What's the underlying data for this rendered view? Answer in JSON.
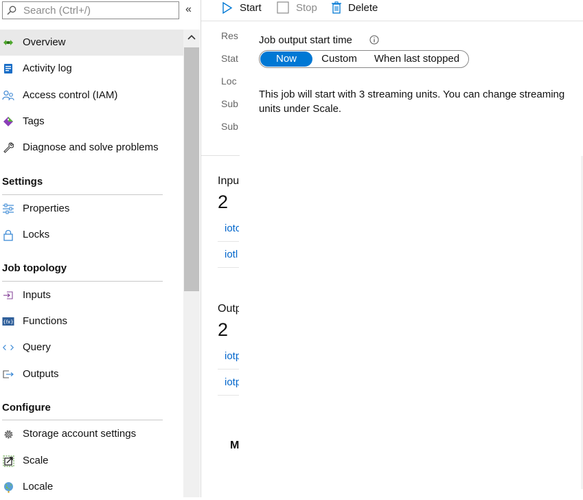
{
  "search": {
    "placeholder": "Search (Ctrl+/)"
  },
  "sidebar": {
    "collapse_glyph": "«",
    "items": [
      {
        "label": "Overview",
        "icon": "overview-icon",
        "active": true
      },
      {
        "label": "Activity log",
        "icon": "activity-log-icon"
      },
      {
        "label": "Access control (IAM)",
        "icon": "access-control-icon"
      },
      {
        "label": "Tags",
        "icon": "tag-icon"
      },
      {
        "label": "Diagnose and solve problems",
        "icon": "wrench-icon"
      }
    ],
    "sections": [
      {
        "title": "Settings",
        "items": [
          {
            "label": "Properties",
            "icon": "properties-icon"
          },
          {
            "label": "Locks",
            "icon": "lock-icon"
          }
        ]
      },
      {
        "title": "Job topology",
        "items": [
          {
            "label": "Inputs",
            "icon": "inputs-icon"
          },
          {
            "label": "Functions",
            "icon": "functions-icon"
          },
          {
            "label": "Query",
            "icon": "query-icon"
          },
          {
            "label": "Outputs",
            "icon": "outputs-icon"
          }
        ]
      },
      {
        "title": "Configure",
        "items": [
          {
            "label": "Storage account settings",
            "icon": "gear-icon"
          },
          {
            "label": "Scale",
            "icon": "scale-icon"
          },
          {
            "label": "Locale",
            "icon": "globe-icon"
          }
        ]
      }
    ]
  },
  "toolbar": {
    "start": "Start",
    "stop": "Stop",
    "delete": "Delete"
  },
  "essentials": [
    "Res",
    "Stat",
    "Loc",
    "Sub",
    "Sub"
  ],
  "tiles": {
    "inputs": {
      "title": "Inpu",
      "count": "2",
      "links": [
        "iotc",
        "iotl"
      ]
    },
    "outputs": {
      "title": "Outp",
      "count": "2",
      "links": [
        "iotp",
        "iotp"
      ]
    },
    "monitoring_peek": "M"
  },
  "flyout": {
    "title": "Job output start time",
    "options": [
      "Now",
      "Custom",
      "When last stopped"
    ],
    "selected": "Now",
    "message": "This job will start with 3 streaming units. You can change streaming units under Scale."
  },
  "colors": {
    "accent": "#0078d4",
    "link": "#0066cc",
    "active_bg": "#e9e9e9"
  }
}
